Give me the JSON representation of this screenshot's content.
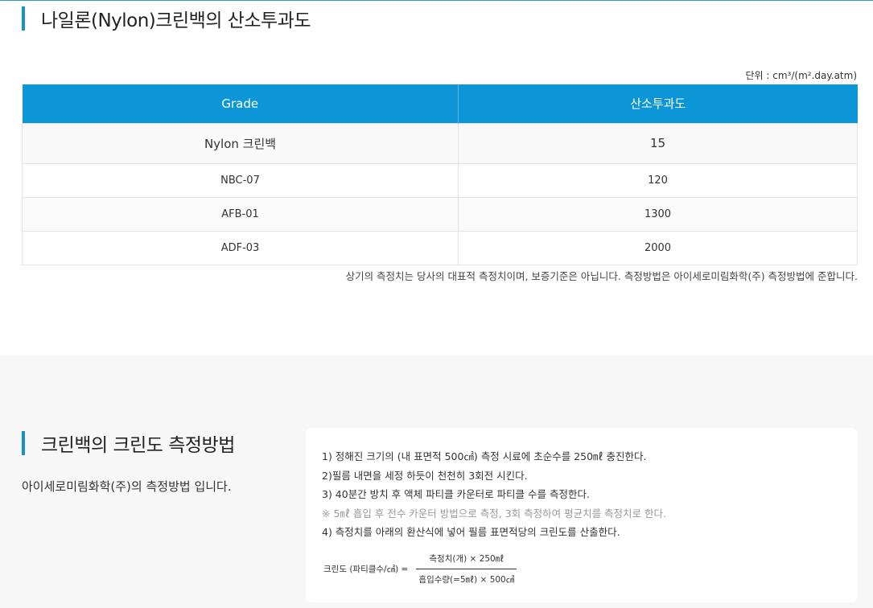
{
  "section1": {
    "title": "나일론(Nylon)크린백의 산소투과도",
    "unit": "단위 : cm³/(m².day.atm)",
    "table": {
      "headers": [
        "Grade",
        "산소투과도"
      ],
      "rows": [
        {
          "grade": "Nylon 크린백",
          "value": "15"
        },
        {
          "grade": "NBC-07",
          "value": "120"
        },
        {
          "grade": "AFB-01",
          "value": "1300"
        },
        {
          "grade": "ADF-03",
          "value": "2000"
        }
      ]
    },
    "note": "상기의 측정치는 당사의 대표적 측정치이며, 보증기준은 아닙니다. 측정방법은 아이세로미림화학(주) 측정방법에 준합니다."
  },
  "section2": {
    "title": "크린백의 크린도 측정방법",
    "description": "아이세로미림화학(주)의 측정방법 입니다.",
    "steps": [
      "1) 정해진 크기의 (내 표면적 500㎠) 측정 시료에 초순수를 250㎖ 충진한다.",
      "2)필름 내면을 세정 하듯이 천천히 3회전 시킨다.",
      "3) 40분간 방치 후 액체 파티클 카운터로 파티클 수를 측정한다.",
      "※ 5㎖ 흡입 후 전수 카운터 방법으로 측정, 3회 측정하여 평균치를 측정치로 한다.",
      "4) 측정치를 아래의 환산식에 넣어 필름 표면적당의 크린도를 산출한다."
    ],
    "formula": {
      "lhs": "크린도 (파티클수/㎠) =",
      "numerator": "측정치(개) × 250㎖",
      "denominator": "흡입수량(=5㎖) × 500㎠"
    }
  },
  "colors": {
    "accent": "#0c96d8",
    "band": "#f7f7f7"
  }
}
